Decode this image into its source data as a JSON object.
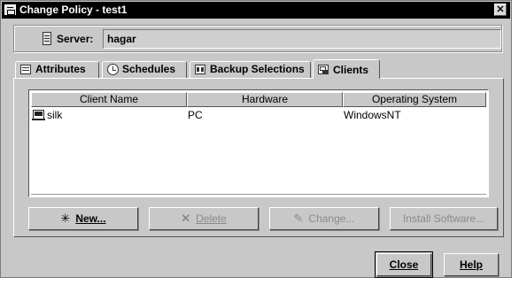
{
  "window": {
    "title": "Change Policy - test1",
    "close_glyph": "✕"
  },
  "server": {
    "label": "Server:",
    "value": "hagar",
    "icon": "server-icon"
  },
  "tabs": [
    {
      "label": "Attributes",
      "icon": "attributes-icon",
      "active": false
    },
    {
      "label": "Schedules",
      "icon": "schedules-icon",
      "active": false
    },
    {
      "label": "Backup Selections",
      "icon": "backup-selections-icon",
      "active": false
    },
    {
      "label": "Clients",
      "icon": "clients-icon",
      "active": true
    }
  ],
  "clients_table": {
    "columns": [
      "Client Name",
      "Hardware",
      "Operating System"
    ],
    "rows": [
      {
        "client_name": "silk",
        "hardware": "PC",
        "operating_system": "WindowsNT",
        "icon": "client-computer-icon"
      }
    ]
  },
  "actions": {
    "new_label": "New...",
    "delete_label": "Delete",
    "change_label": "Change...",
    "install_label": "Install Software...",
    "new_icon": "new-star-icon",
    "delete_icon": "delete-x-icon",
    "change_icon": "change-pencil-icon",
    "disabled_color": "#8a8a8a"
  },
  "footer": {
    "close_label": "Close",
    "help_label": "Help"
  },
  "colors": {
    "dialog_bg": "#c8c8c8",
    "titlebar_bg": "#000000",
    "list_bg": "#ffffff"
  }
}
